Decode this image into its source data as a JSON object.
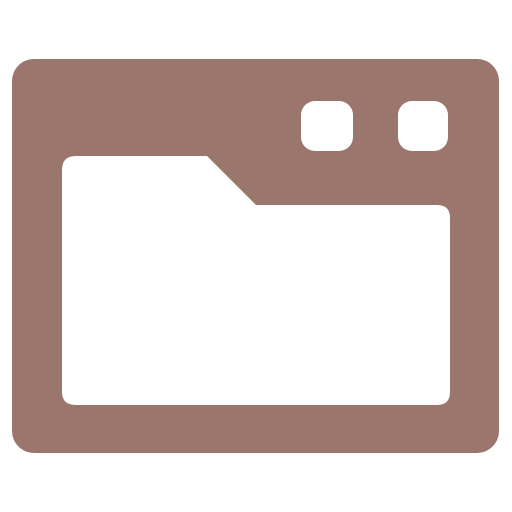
{
  "icon": {
    "name": "browser-window-folder-icon",
    "colors": {
      "frame": "#9B766C",
      "content": "#FFFFFF"
    },
    "window_controls": [
      {
        "name": "window-control-left"
      },
      {
        "name": "window-control-right"
      }
    ]
  }
}
